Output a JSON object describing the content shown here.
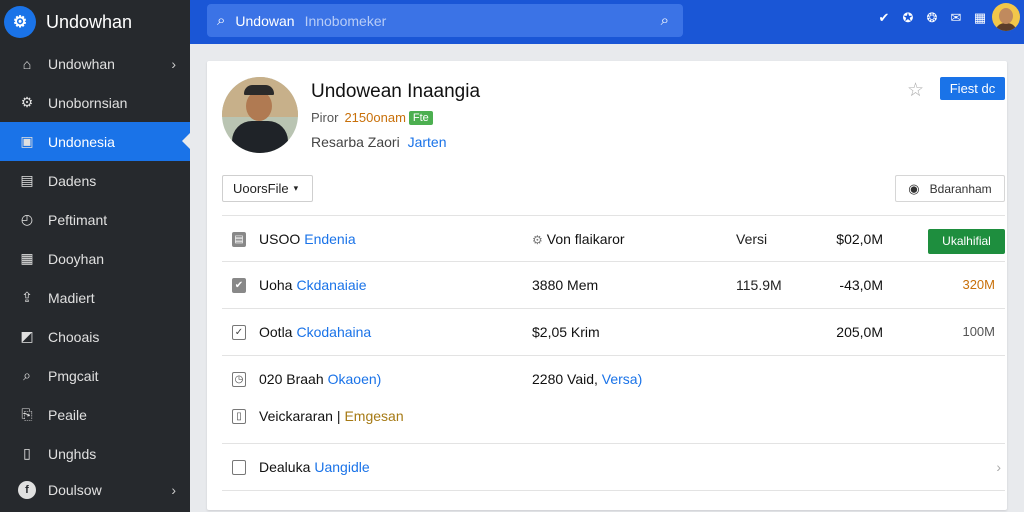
{
  "brand": {
    "logo": "⚙",
    "name": "Undowhan"
  },
  "sidebar": {
    "items": [
      {
        "label": "Undowhan",
        "icon": "⌂",
        "chevron": "›"
      },
      {
        "label": "Unobornsian",
        "icon": "⚙"
      },
      {
        "label": "Undonesia",
        "icon": "▣",
        "active": true
      },
      {
        "label": "Dadens",
        "icon": "▤"
      },
      {
        "label": "Peftimant",
        "icon": "◴"
      },
      {
        "label": "Dooyhan",
        "icon": "▦"
      },
      {
        "label": "Madiert",
        "icon": "⇪"
      },
      {
        "label": "Chooais",
        "icon": "◩"
      },
      {
        "label": "Pmgcait",
        "icon": "⌕"
      },
      {
        "label": "Peaile",
        "icon": "⎘"
      },
      {
        "label": "Unghds",
        "icon": "▯"
      }
    ],
    "bottom": {
      "label": "Doulsow",
      "icon": "f",
      "chevron": "›"
    }
  },
  "search": {
    "icon": "⌕",
    "value": "Undowan",
    "placeholder": "Innobomeker"
  },
  "top_icons": [
    "✔",
    "✪",
    "❂",
    "✉",
    "▦"
  ],
  "profile": {
    "name": "Undowean Inaangia",
    "meta_label": "Piror",
    "meta_value": "2150onam",
    "meta_badge": "Fte",
    "sub_text": "Resarba Zaori",
    "sub_link": "Jarten",
    "star": "☆",
    "primary_button": "Fiest dc"
  },
  "toolbar": {
    "dropdown": "UoorsFile",
    "dropdown_arrow": "▾",
    "secondary_icon": "◉",
    "secondary_button": "Bdaranham"
  },
  "rows": [
    {
      "icon": "▤",
      "doc": true,
      "name": "USOO",
      "link": "Endenia",
      "c2_icon": "⚙",
      "c2": "Von flaikaror",
      "c3": "Versi",
      "c4": "$02,0M",
      "action": "Ukalhifial"
    },
    {
      "icon": "✔",
      "doc": true,
      "name": "Uoha",
      "link": "Ckdanaiaie",
      "c2": "3880 Mem",
      "c3": "115.9M",
      "c4": "-43,0M",
      "c5": "320M",
      "c5_orange": true
    },
    {
      "icon": "✓",
      "name": "Ootla",
      "link": "Ckodahaina",
      "c2": "$2,05 Krim",
      "c4": "205,0M",
      "c5": "100M"
    },
    {
      "icon": "◷",
      "name": "020 Braah",
      "link": "Okaoen)",
      "c2": "2280 Vaid,",
      "c2_link": "Versa)"
    },
    {
      "icon": "▯",
      "name": "Veickararan |",
      "link_gold": "Emgesan"
    },
    {
      "icon": "",
      "name": "Dealuka",
      "link": "Uangidle",
      "more": "›"
    }
  ]
}
